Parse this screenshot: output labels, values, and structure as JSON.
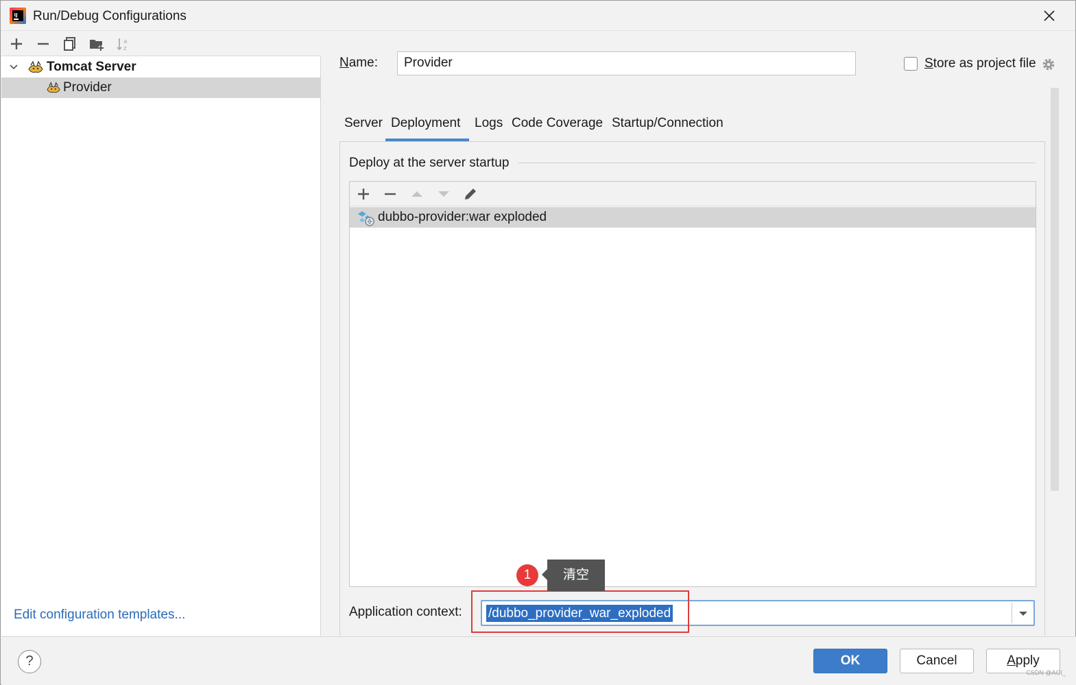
{
  "window": {
    "title": "Run/Debug Configurations"
  },
  "left_panel": {
    "toolbar_icons": [
      "plus-icon",
      "minus-icon",
      "copy-icon",
      "folder-add-icon",
      "sort-icon"
    ],
    "tree": [
      {
        "label": "Tomcat Server",
        "expanded": true,
        "bold": true
      },
      {
        "label": "Provider",
        "selected": true
      }
    ],
    "edit_templates_link": "Edit configuration templates..."
  },
  "config": {
    "name_label": "Name:",
    "name_value": "Provider",
    "store_label": "Store as project file",
    "store_checked": false
  },
  "tabs": [
    {
      "label": "Server"
    },
    {
      "label": "Deployment",
      "active": true
    },
    {
      "label": "Logs"
    },
    {
      "label": "Code Coverage"
    },
    {
      "label": "Startup/Connection"
    }
  ],
  "deployment": {
    "group_title": "Deploy at the server startup",
    "toolbar_icons": [
      "plus-icon",
      "minus-icon",
      "arrow-up-icon",
      "arrow-down-icon",
      "pencil-icon"
    ],
    "artifacts": [
      {
        "label": "dubbo-provider:war exploded",
        "selected": true
      }
    ],
    "context_label": "Application context:",
    "context_value": "/dubbo_provider_war_exploded"
  },
  "annotation": {
    "badge": "1",
    "tooltip": "清空",
    "highlight_color": "#e03a3a"
  },
  "buttons": {
    "help": "?",
    "ok": "OK",
    "cancel": "Cancel",
    "apply": "Apply"
  },
  "watermark": "CSDN @AGI_",
  "colors": {
    "accent": "#3d7cc9",
    "link": "#2a6ab8",
    "selection": "#2d6ec2"
  }
}
